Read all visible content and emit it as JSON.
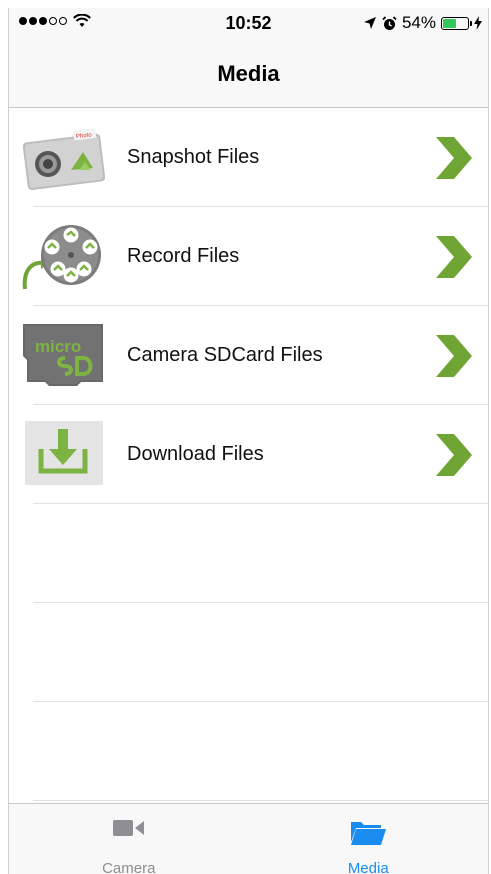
{
  "status_bar": {
    "time": "10:52",
    "battery_percent": "54%",
    "battery_level": 0.54,
    "signal_bars_filled": 3,
    "signal_bars_total": 5
  },
  "nav": {
    "title": "Media"
  },
  "list": {
    "items": [
      {
        "label": "Snapshot Files",
        "icon": "snapshot-camera-icon"
      },
      {
        "label": "Record Files",
        "icon": "film-reel-icon"
      },
      {
        "label": "Camera SDCard Files",
        "icon": "microsd-card-icon"
      },
      {
        "label": "Download Files",
        "icon": "download-tray-icon"
      }
    ],
    "chevron_icon": "chevron-right-icon",
    "chevron_color": "#6ea534"
  },
  "tabs": [
    {
      "label": "Camera",
      "icon": "video-camera-icon",
      "color": "#8e8e93",
      "selected": false
    },
    {
      "label": "Media",
      "icon": "folder-icon",
      "color": "#1a8cf0",
      "selected": true
    }
  ],
  "colors": {
    "accent_green": "#6ea534",
    "tab_active": "#1a8cf0",
    "tab_inactive": "#8e8e93",
    "battery": "#34c759"
  }
}
